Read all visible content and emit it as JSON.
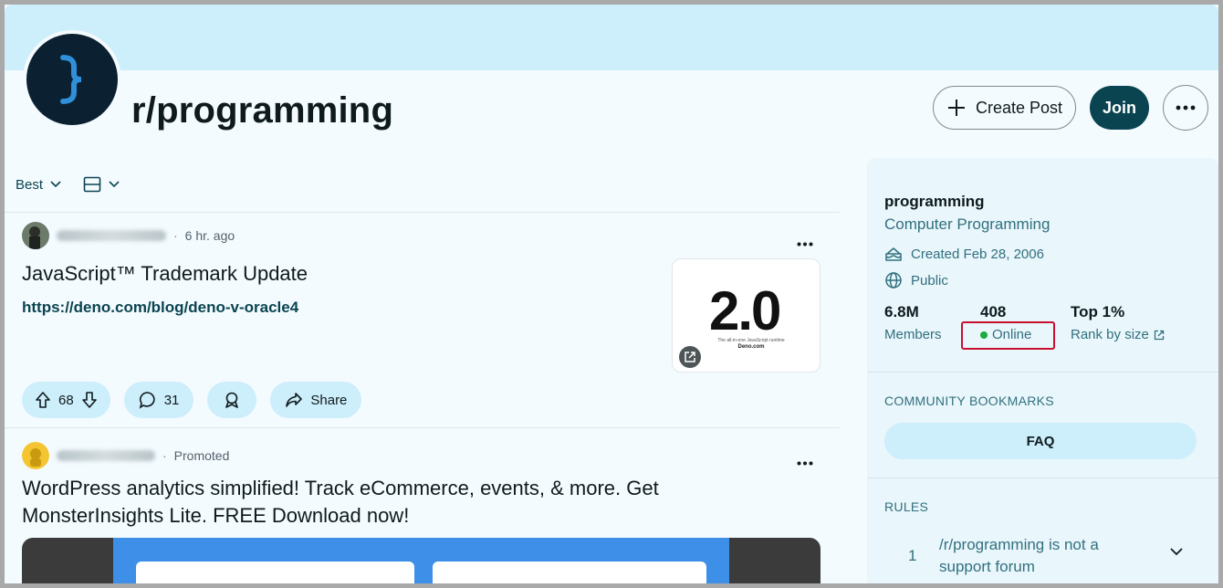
{
  "community": {
    "title": "r/programming",
    "create_post_label": "Create Post",
    "join_label": "Join"
  },
  "feed_toolbar": {
    "sort_label": "Best"
  },
  "posts": [
    {
      "age": "6 hr. ago",
      "title": "JavaScript™ Trademark Update",
      "link": "https://deno.com/blog/deno-v-oracle4",
      "thumbnail_text": "2.0",
      "thumbnail_caption": "The all-in-one JavaScript runtime",
      "thumbnail_site": "Deno.com",
      "upvotes": "68",
      "comments": "31",
      "share_label": "Share"
    },
    {
      "age": "Promoted",
      "title_line1": "WordPress analytics simplified! Track eCommerce, events, & more. Get",
      "title_line2": "MonsterInsights Lite. FREE Download now!"
    }
  ],
  "sidebar": {
    "name": "programming",
    "description": "Computer Programming",
    "created": "Created Feb 28, 2006",
    "visibility": "Public",
    "stats": [
      {
        "value": "6.8M",
        "label": "Members"
      },
      {
        "value": "408",
        "label": "Online"
      },
      {
        "value": "Top 1%",
        "label": "Rank by size"
      }
    ],
    "bookmarks_heading": "COMMUNITY BOOKMARKS",
    "faq_label": "FAQ",
    "rules_heading": "RULES",
    "rules": [
      {
        "number": "1",
        "text": "/r/programming is not a support forum"
      }
    ]
  },
  "colors": {
    "banner": "#cdeefb",
    "join_button": "#0a4450",
    "online_dot": "#1aab3f",
    "highlight": "#c8102e"
  }
}
